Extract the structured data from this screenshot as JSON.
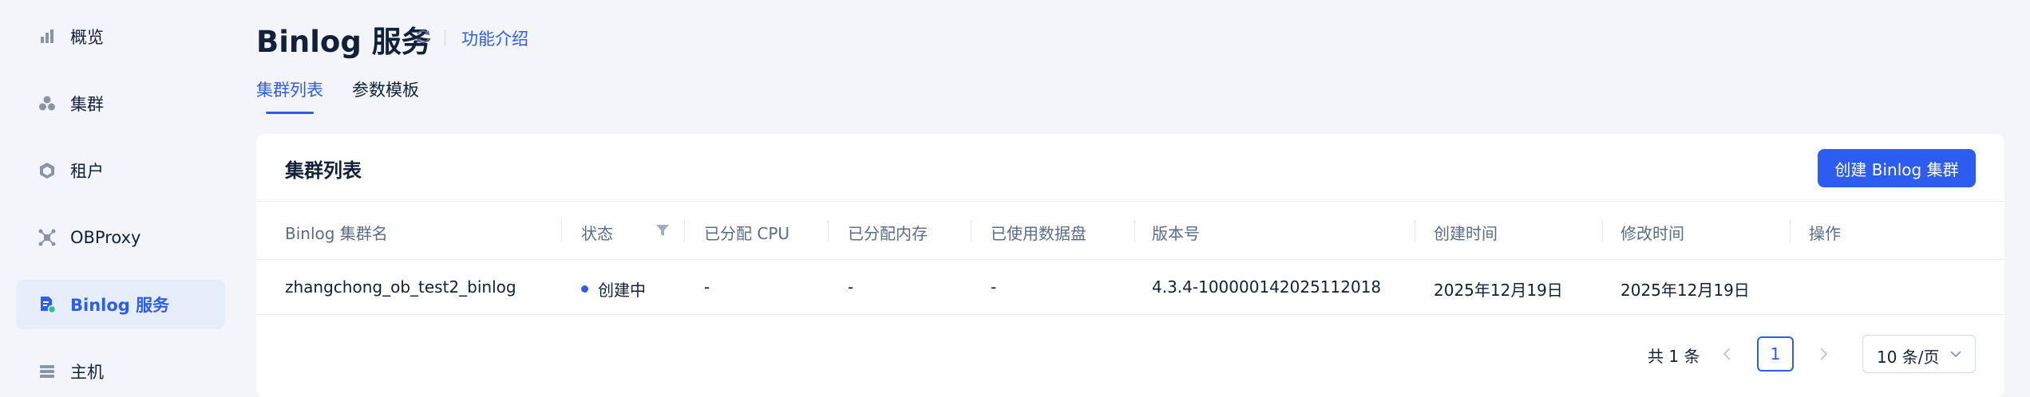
{
  "sidebar": {
    "items": [
      {
        "label": "概览",
        "icon": "chart-bar-icon"
      },
      {
        "label": "集群",
        "icon": "cluster-icon"
      },
      {
        "label": "租户",
        "icon": "tenant-cube-icon"
      },
      {
        "label": "OBProxy",
        "icon": "proxy-network-icon"
      },
      {
        "label": "Binlog 服务",
        "icon": "binlog-file-icon",
        "active": true
      },
      {
        "label": "主机",
        "icon": "host-server-icon"
      }
    ]
  },
  "header": {
    "title": "Binlog 服务",
    "intro_link": "功能介绍",
    "tabs": [
      {
        "label": "集群列表",
        "active": true
      },
      {
        "label": "参数模板",
        "active": false
      }
    ]
  },
  "card": {
    "title": "集群列表",
    "create_button": "创建 Binlog 集群",
    "columns": [
      "Binlog 集群名",
      "状态",
      "已分配 CPU",
      "已分配内存",
      "已使用数据盘",
      "版本号",
      "创建时间",
      "修改时间",
      "操作"
    ],
    "rows": [
      {
        "name": "zhangchong_ob_test2_binlog",
        "status": "创建中",
        "cpu": "-",
        "memory": "-",
        "disk": "-",
        "version": "4.3.4-100000142025112018",
        "created": "2025年12月19日",
        "modified": "2025年12月19日",
        "actions": ""
      }
    ]
  },
  "pagination": {
    "total": "共 1 条",
    "current_page": "1",
    "page_size": "10 条/页"
  },
  "colors": {
    "accent": "#2d5cf0",
    "background": "#f3f5fa",
    "active_nav_bg": "#e6edfb",
    "status_creating": "#2d5cf0"
  }
}
